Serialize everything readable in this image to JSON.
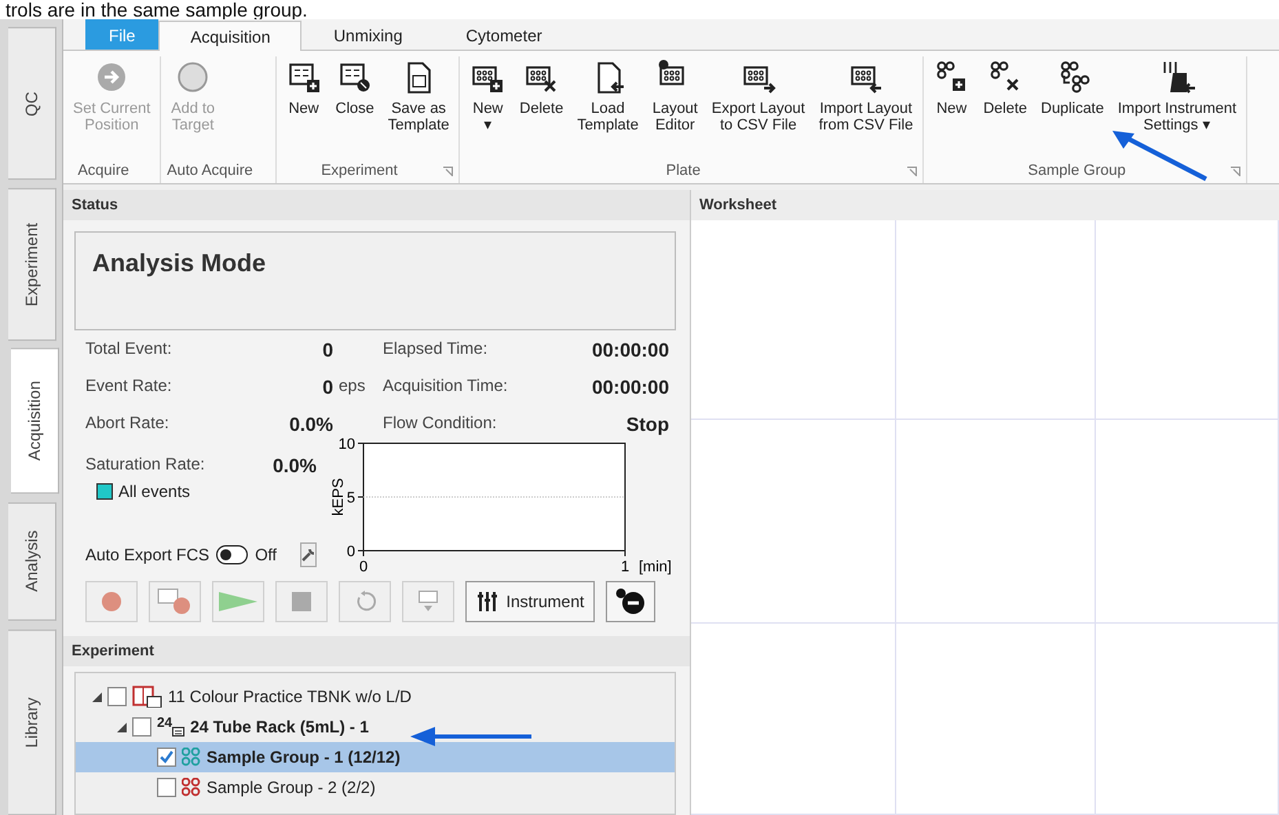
{
  "caption": "trols are in the same sample group.",
  "side_tabs": [
    {
      "label": "QC",
      "selected": false
    },
    {
      "label": "Experiment",
      "selected": false
    },
    {
      "label": "Acquisition",
      "selected": true
    },
    {
      "label": "Analysis",
      "selected": false
    },
    {
      "label": "Library",
      "selected": false
    }
  ],
  "ribbon_tabs": [
    {
      "label": "File",
      "kind": "file",
      "selected": false
    },
    {
      "label": "Acquisition",
      "kind": "tab",
      "selected": true
    },
    {
      "label": "Unmixing",
      "kind": "tab",
      "selected": false
    },
    {
      "label": "Cytometer",
      "kind": "tab",
      "selected": false
    }
  ],
  "ribbon_groups": [
    {
      "label": "Acquire",
      "launcher": false,
      "buttons": [
        {
          "lines": [
            "Set Current",
            "Position"
          ],
          "kind": "position",
          "disabled": true
        }
      ]
    },
    {
      "label": "Auto Acquire",
      "launcher": false,
      "buttons": [
        {
          "lines": [
            "Add to",
            "Target"
          ],
          "kind": "target",
          "disabled": true
        }
      ]
    },
    {
      "label": "Experiment",
      "launcher": true,
      "buttons": [
        {
          "lines": [
            "New"
          ],
          "kind": "newlist",
          "disabled": false
        },
        {
          "lines": [
            "Close"
          ],
          "kind": "closelist",
          "disabled": false
        },
        {
          "lines": [
            "Save as",
            "Template"
          ],
          "kind": "template",
          "disabled": false
        }
      ]
    },
    {
      "label": "Plate",
      "launcher": true,
      "buttons": [
        {
          "lines": [
            "New"
          ],
          "kind": "newplate",
          "disabled": false,
          "caret": "▾"
        },
        {
          "lines": [
            "Delete"
          ],
          "kind": "deleteplate",
          "disabled": false
        },
        {
          "lines": [
            "Load",
            "Template"
          ],
          "kind": "loadtemplate",
          "disabled": false
        },
        {
          "lines": [
            "Layout",
            "Editor"
          ],
          "kind": "editor",
          "disabled": false
        },
        {
          "lines": [
            "Export Layout",
            "to CSV File"
          ],
          "kind": "export",
          "disabled": false
        },
        {
          "lines": [
            "Import Layout",
            "from CSV File"
          ],
          "kind": "import",
          "disabled": false
        }
      ]
    },
    {
      "label": "Sample Group",
      "launcher": true,
      "buttons": [
        {
          "lines": [
            "New"
          ],
          "kind": "newgroup",
          "disabled": false
        },
        {
          "lines": [
            "Delete"
          ],
          "kind": "deletegroup",
          "disabled": false
        },
        {
          "lines": [
            "Duplicate"
          ],
          "kind": "duplicate",
          "disabled": false
        },
        {
          "lines": [
            "Import Instrument",
            "Settings"
          ],
          "kind": "settings",
          "disabled": false,
          "caret": "▾"
        }
      ]
    }
  ],
  "status": {
    "title": "Status",
    "mode": "Analysis Mode",
    "stats": [
      {
        "label": "Total Event:",
        "value": "0"
      },
      {
        "label": "Elapsed Time:",
        "value": "00:00:00"
      },
      {
        "label": "Event Rate:",
        "value": "0",
        "unit": "eps"
      },
      {
        "label": "Acquisition Time:",
        "value": "00:00:00"
      },
      {
        "label": "Abort Rate:",
        "value": "0.0%"
      },
      {
        "label": "Flow Condition:",
        "value": "Stop"
      }
    ],
    "saturation": {
      "label": "Saturation Rate:",
      "value": "0.0%"
    },
    "legend": {
      "label": "All events",
      "color": "#20c8c8"
    },
    "chart_data": {
      "type": "line",
      "ylabel": "kEPS",
      "xlabel": "[min]",
      "xlim": [
        0,
        1
      ],
      "ylim": [
        0,
        10
      ],
      "xticks": [
        0,
        1
      ],
      "yticks": [
        0,
        5,
        10
      ]
    },
    "auto_export": {
      "label": "Auto Export FCS",
      "on": false,
      "state_text": "Off"
    },
    "actions": [
      {
        "kind": "record",
        "disabled": true
      },
      {
        "kind": "recordplate",
        "disabled": true
      },
      {
        "kind": "play",
        "disabled": true
      },
      {
        "kind": "stop",
        "disabled": true
      },
      {
        "kind": "reset",
        "disabled": true
      },
      {
        "kind": "eject",
        "disabled": true
      },
      {
        "kind": "instrument",
        "label": "Instrument",
        "disabled": false
      },
      {
        "kind": "connect",
        "disabled": false
      }
    ]
  },
  "experiment": {
    "title": "Experiment",
    "tree": [
      {
        "label": "11 Colour Practice TBNK w/o L/D",
        "kind": "experiment",
        "checked": false,
        "selected": false,
        "expanded": true,
        "bold": false,
        "children": [
          {
            "label": "24 Tube Rack (5mL) - 1",
            "kind": "rack",
            "badge": "24",
            "checked": false,
            "selected": false,
            "expanded": true,
            "bold": true,
            "children": [
              {
                "label": "Sample Group - 1 (12/12)",
                "kind": "group",
                "color": "#20a0a0",
                "checked": true,
                "selected": true,
                "bold": true
              },
              {
                "label": "Sample Group - 2 (2/2)",
                "kind": "group",
                "color": "#c03030",
                "checked": false,
                "selected": false,
                "bold": false
              }
            ]
          }
        ]
      }
    ]
  },
  "worksheet": {
    "title": "Worksheet"
  }
}
